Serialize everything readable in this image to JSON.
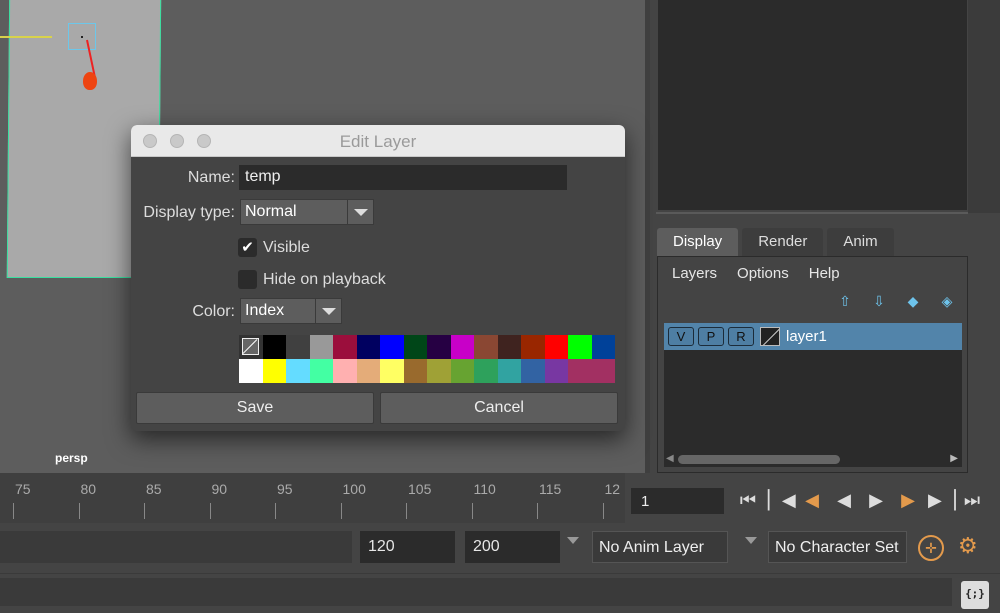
{
  "viewport": {
    "camera_label": "persp"
  },
  "dialog": {
    "title": "Edit Layer",
    "name_label": "Name:",
    "name_value": "temp",
    "display_type_label": "Display type:",
    "display_type_value": "Normal",
    "visible_label": "Visible",
    "visible_checked": true,
    "hide_on_playback_label": "Hide on playback",
    "hide_on_playback_checked": false,
    "color_label": "Color:",
    "color_mode_value": "Index",
    "palette": [
      "none",
      "#000000",
      "#404040",
      "#999999",
      "#9b0e3c",
      "#000060",
      "#0000ff",
      "#004618",
      "#260043",
      "#c800c8",
      "#8a4733",
      "#3f231f",
      "#992600",
      "#ff0000",
      "#00ff00",
      "#004199",
      "#ffffff",
      "#ffff00",
      "#64dcff",
      "#43ffa3",
      "#ffb0b0",
      "#e4ac79",
      "#ffff63",
      "#996a2d",
      "#9fa136",
      "#67a331",
      "#2ea15c",
      "#31a3a1",
      "#3263a3",
      "#7837a2",
      "#a23062",
      "#a23062"
    ],
    "save_label": "Save",
    "cancel_label": "Cancel"
  },
  "layer_editor": {
    "tabs": [
      "Display",
      "Render",
      "Anim"
    ],
    "active_tab": "Display",
    "menu": [
      "Layers",
      "Options",
      "Help"
    ],
    "icons": [
      "move-layer-up-icon",
      "move-layer-down-icon",
      "new-empty-layer-icon",
      "new-layer-from-selection-icon"
    ],
    "layer": {
      "v": "V",
      "p": "P",
      "r": "R",
      "name": "layer1"
    }
  },
  "timeline": {
    "frames": [
      "75",
      "80",
      "85",
      "90",
      "95",
      "100",
      "105",
      "110",
      "115",
      "12"
    ],
    "current_frame": "1"
  },
  "range": {
    "end_value": "120",
    "max_value": "200",
    "anim_layer": "No Anim Layer",
    "character_set": "No Character Set"
  },
  "command_line": {
    "script_editor_label": "{;}"
  }
}
